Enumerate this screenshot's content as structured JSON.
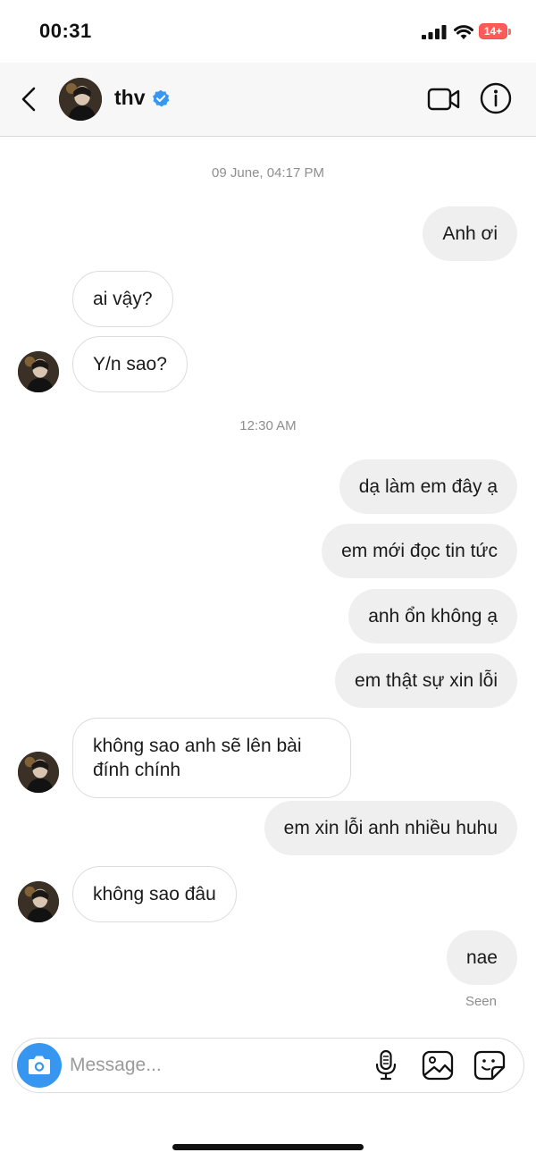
{
  "status_bar": {
    "time": "00:31",
    "battery": "14+",
    "icons": [
      "signal-icon",
      "wifi-icon",
      "battery-icon"
    ]
  },
  "header": {
    "name": "thv",
    "verified": true,
    "icons": [
      "back-icon",
      "avatar",
      "verified-icon",
      "video-call-icon",
      "info-icon"
    ]
  },
  "chat": {
    "timestamps": [
      "09 June, 04:17 PM",
      "12:30 AM"
    ],
    "messages": [
      {
        "from": "me",
        "text": "Anh ơi"
      },
      {
        "from": "them",
        "text": "ai vậy?"
      },
      {
        "from": "them",
        "text": "Y/n sao?"
      },
      {
        "from": "me",
        "text": "dạ làm em đây ạ"
      },
      {
        "from": "me",
        "text": "em mới đọc tin tức"
      },
      {
        "from": "me",
        "text": "anh ổn không ạ"
      },
      {
        "from": "me",
        "text": "em thật sự xin lỗi"
      },
      {
        "from": "them",
        "text": "không sao anh sẽ lên bài đính chính"
      },
      {
        "from": "me",
        "text": "em xin lỗi anh nhiều huhu"
      },
      {
        "from": "them",
        "text": "không sao đâu"
      },
      {
        "from": "me",
        "text": "nae"
      }
    ],
    "seen_label": "Seen"
  },
  "composer": {
    "placeholder": "Message...",
    "value": "",
    "icons": [
      "camera-icon",
      "microphone-icon",
      "gallery-icon",
      "sticker-icon"
    ]
  },
  "colors": {
    "accent": "#3797f0",
    "outgoing_bubble": "#efefef",
    "incoming_border": "#dcdcdc",
    "battery": "#ff5a5a",
    "verified": "#3897f0"
  }
}
